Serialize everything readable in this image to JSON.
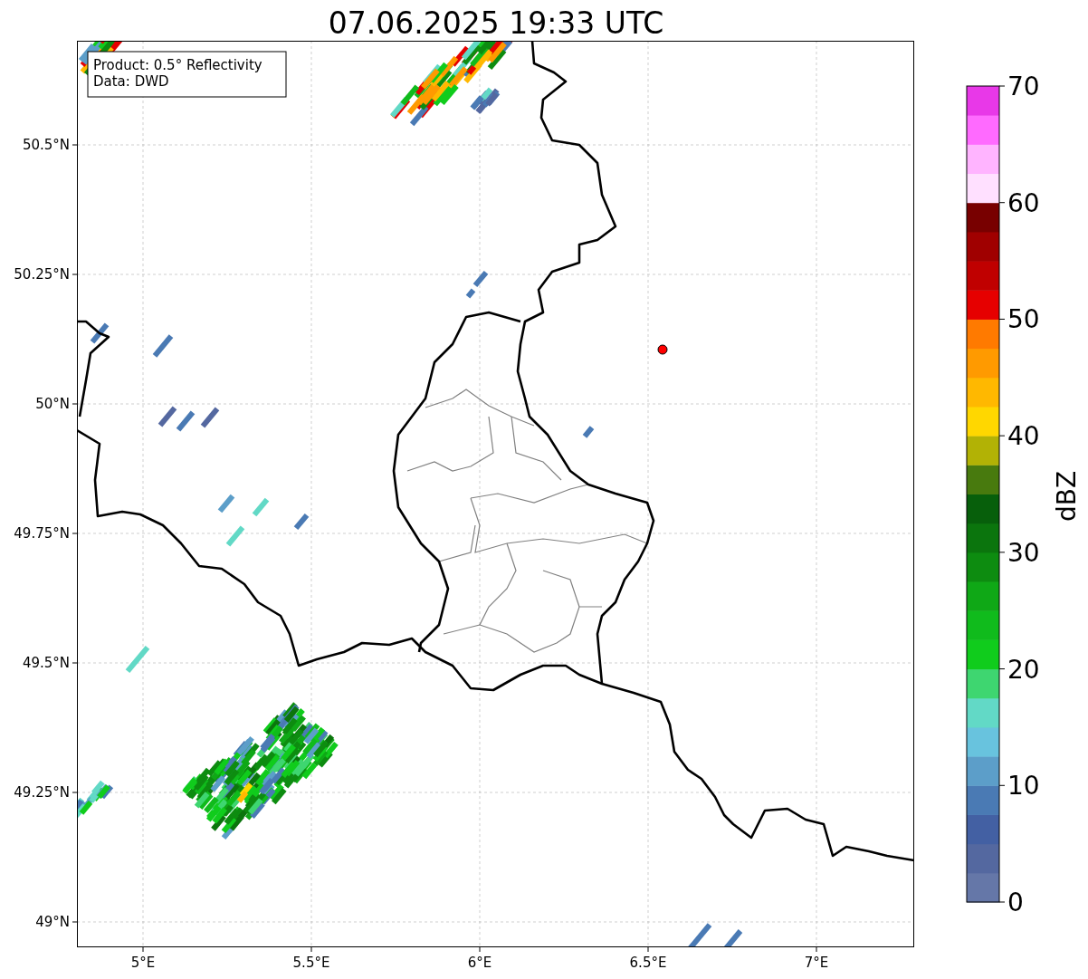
{
  "title": "07.06.2025 19:33 UTC",
  "info_box": {
    "lines": [
      "Product: 0.5° Reflectivity",
      "Data: DWD"
    ]
  },
  "lat_ticks": [
    "50.5°N",
    "50.25°N",
    "50°N",
    "49.75°N",
    "49.5°N",
    "49.25°N",
    "49°N"
  ],
  "lon_ticks": [
    "5°E",
    "5.5°E",
    "6°E",
    "6.5°E",
    "7°E"
  ],
  "colorbar": {
    "label": "dBZ",
    "ticks": [
      "70",
      "60",
      "50",
      "40",
      "30",
      "20",
      "10",
      "0"
    ],
    "bins": [
      {
        "color": "#6577a8"
      },
      {
        "color": "#5468a0"
      },
      {
        "color": "#4360a3"
      },
      {
        "color": "#4a7ab4"
      },
      {
        "color": "#5c9ec9"
      },
      {
        "color": "#68c3de"
      },
      {
        "color": "#62d9c6"
      },
      {
        "color": "#3ed670"
      },
      {
        "color": "#10cc1c"
      },
      {
        "color": "#10bb1c"
      },
      {
        "color": "#0fa816"
      },
      {
        "color": "#0d8c10"
      },
      {
        "color": "#0b750d"
      },
      {
        "color": "#075f0b"
      },
      {
        "color": "#487a0e"
      },
      {
        "color": "#b2b205"
      },
      {
        "color": "#ffd700"
      },
      {
        "color": "#ffb800"
      },
      {
        "color": "#ff9a00"
      },
      {
        "color": "#ff7a00"
      },
      {
        "color": "#e60000"
      },
      {
        "color": "#c00000"
      },
      {
        "color": "#a00000"
      },
      {
        "color": "#780000"
      },
      {
        "color": "#ffe0ff"
      },
      {
        "color": "#ffb4ff"
      },
      {
        "color": "#ff6aff"
      },
      {
        "color": "#e838e8"
      }
    ]
  }
}
